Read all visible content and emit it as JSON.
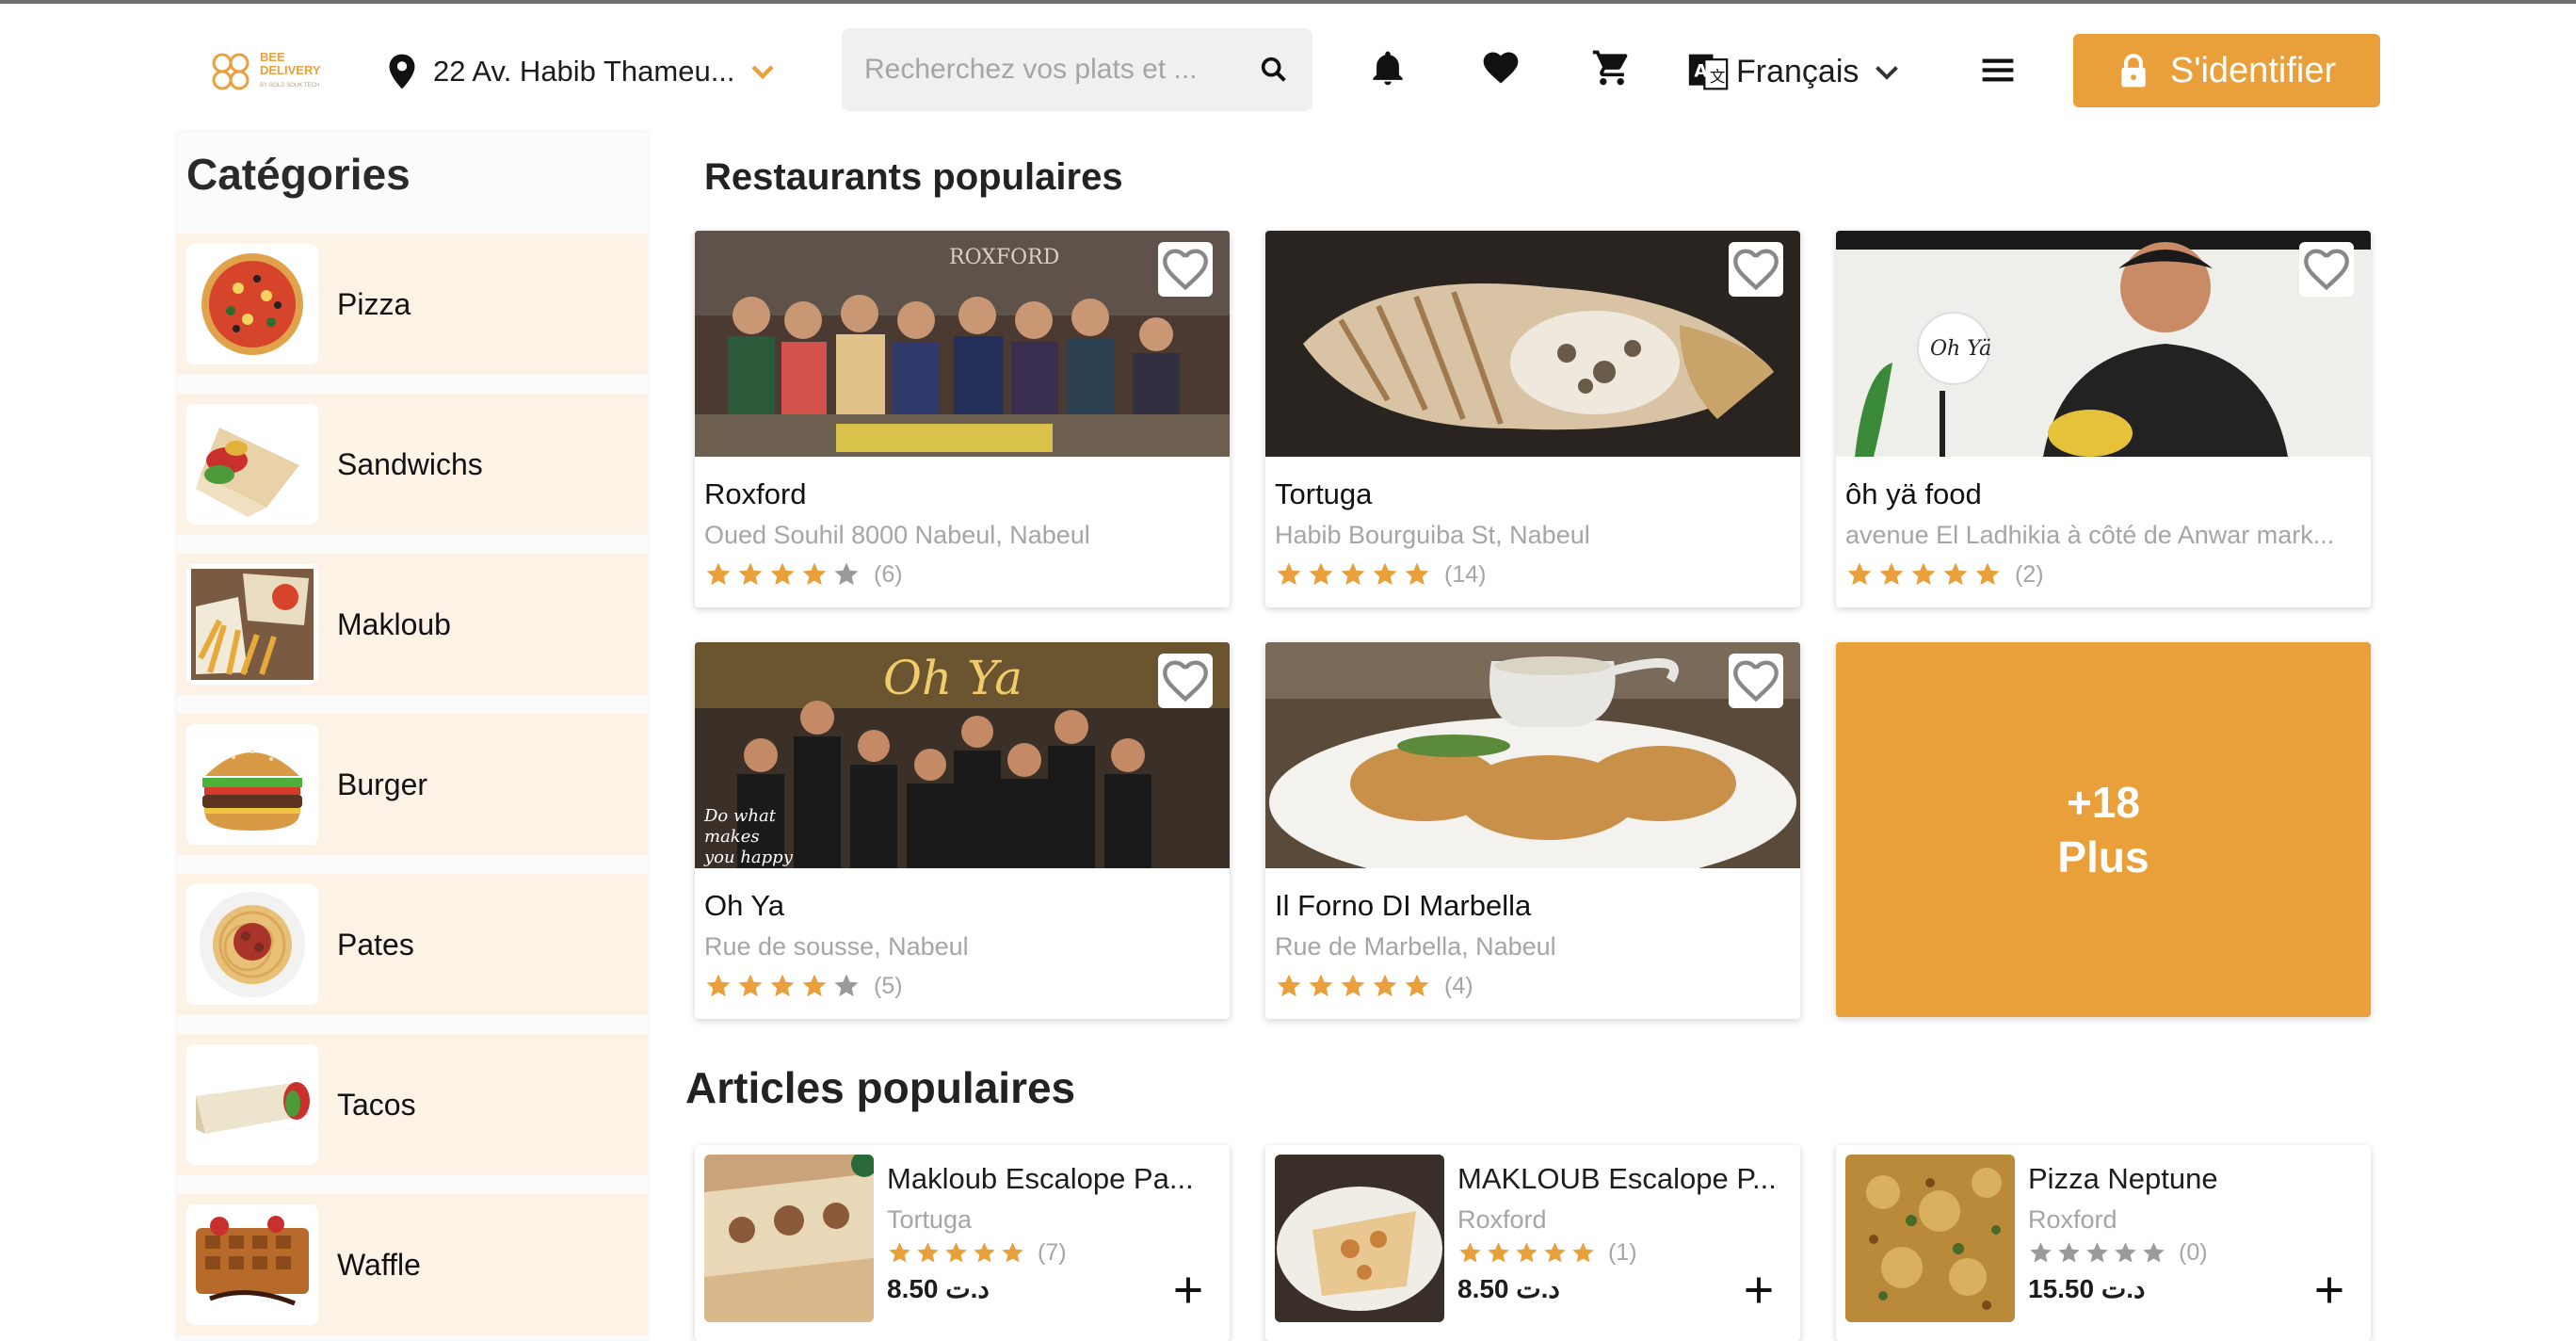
{
  "header": {
    "logo_line1": "BEE",
    "logo_line2": "DELIVERY",
    "logo_sub": "BY GOLD SOUK TECH",
    "address": "22 Av. Habib Thameu...",
    "search_placeholder": "Recherchez vos plats et ...",
    "language": "Français",
    "login_label": "S'identifier",
    "accent_color": "#e9a03b"
  },
  "sidebar": {
    "title": "Catégories",
    "items": [
      {
        "label": "Pizza",
        "icon": "pizza"
      },
      {
        "label": "Sandwichs",
        "icon": "wrap"
      },
      {
        "label": "Makloub",
        "icon": "makloub"
      },
      {
        "label": "Burger",
        "icon": "burger"
      },
      {
        "label": "Pates",
        "icon": "pasta"
      },
      {
        "label": "Tacos",
        "icon": "tacos"
      },
      {
        "label": "Waffle",
        "icon": "waffle"
      }
    ]
  },
  "restaurants": {
    "title": "Restaurants populaires",
    "items": [
      {
        "name": "Roxford",
        "address": "Oued Souhil 8000 Nabeul, Nabeul",
        "rating": 4,
        "count": "(6)"
      },
      {
        "name": "Tortuga",
        "address": "Habib Bourguiba St, Nabeul",
        "rating": 5,
        "count": "(14)"
      },
      {
        "name": "ôh yä food",
        "address": "avenue El Ladhikia à côté de Anwar mark...",
        "rating": 5,
        "count": "(2)"
      },
      {
        "name": "Oh Ya",
        "address": "Rue de sousse, Nabeul",
        "rating": 4,
        "count": "(5)"
      },
      {
        "name": "Il Forno DI Marbella",
        "address": "Rue de Marbella, Nabeul",
        "rating": 5,
        "count": "(4)"
      }
    ],
    "more_count": "+18",
    "more_label": "Plus"
  },
  "articles": {
    "title": "Articles populaires",
    "items": [
      {
        "name": "Makloub Escalope Pa...",
        "restaurant": "Tortuga",
        "rating": 5,
        "count": "(7)",
        "price": "8.50 د.ت"
      },
      {
        "name": "MAKLOUB Escalope P...",
        "restaurant": "Roxford",
        "rating": 5,
        "count": "(1)",
        "price": "8.50 د.ت"
      },
      {
        "name": "Pizza Neptune",
        "restaurant": "Roxford",
        "rating": 0,
        "count": "(0)",
        "price": "15.50 د.ت"
      }
    ]
  }
}
